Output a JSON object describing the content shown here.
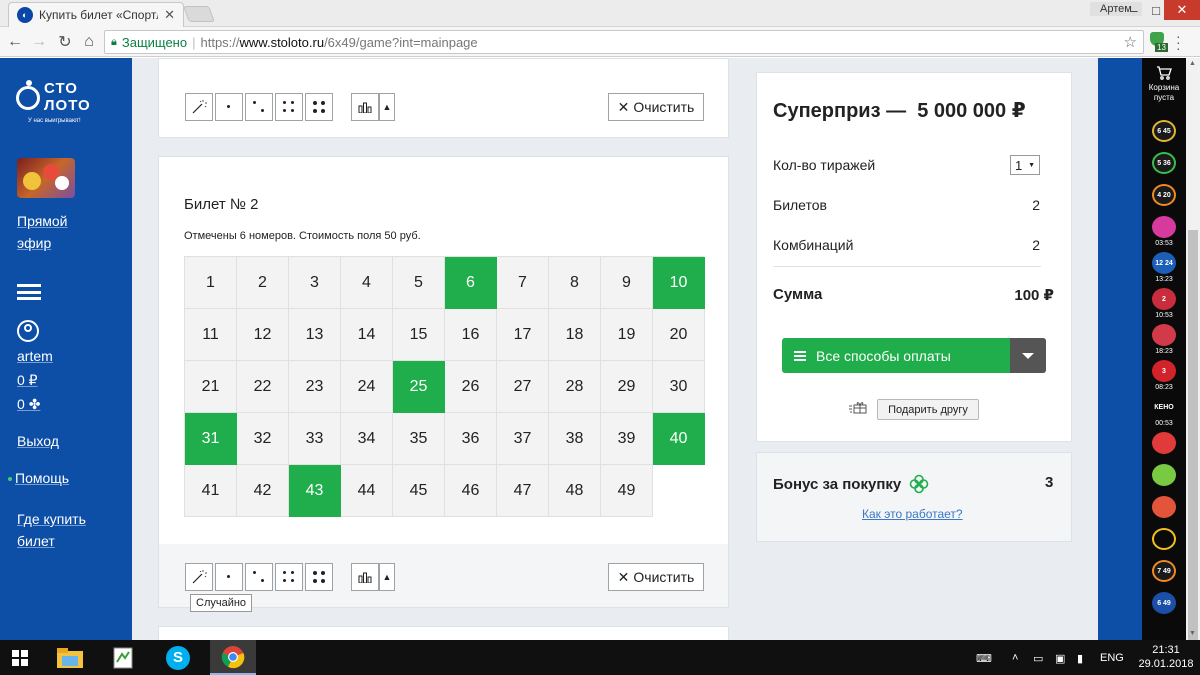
{
  "browser": {
    "tab_title": "Купить билет «Спортлото",
    "user": "Артем",
    "secure_label": "Защищено",
    "url_scheme": "https://",
    "url_host": "www.stoloto.ru",
    "url_path": "/6x49/game?int=mainpage",
    "extension_count": "13"
  },
  "logo": {
    "line1": "СТО",
    "line2": "ЛОТО",
    "slogan": "У нас выигрывают!"
  },
  "sidebar": {
    "live_line1": "Прямой",
    "live_line2": "эфир",
    "username": "artem",
    "balance": "0 ₽",
    "bonus_balance": "0",
    "logout": "Выход",
    "help": "Помощь",
    "where_line1": "Где купить",
    "where_line2": "билет"
  },
  "ticket": {
    "title": "Билет № 2",
    "note": "Отмечены 6 номеров. Стоимость поля 50 руб.",
    "numbers": [
      1,
      2,
      3,
      4,
      5,
      6,
      7,
      8,
      9,
      10,
      11,
      12,
      13,
      14,
      15,
      16,
      17,
      18,
      19,
      20,
      21,
      22,
      23,
      24,
      25,
      26,
      27,
      28,
      29,
      30,
      31,
      32,
      33,
      34,
      35,
      36,
      37,
      38,
      39,
      40,
      41,
      42,
      43,
      44,
      45,
      46,
      47,
      48,
      49
    ],
    "selected": [
      6,
      10,
      25,
      31,
      40,
      43
    ],
    "clear_label": "Очистить",
    "random_tooltip": "Случайно"
  },
  "summary": {
    "prize_label": "Суперприз —",
    "prize_value": "5 000 000 ₽",
    "draws_label": "Кол-во тиражей",
    "draws_value": "1",
    "tickets_label": "Билетов",
    "tickets_value": "2",
    "combos_label": "Комбинаций",
    "combos_value": "2",
    "total_label": "Сумма",
    "total_value": "100 ₽",
    "pay_label": "Все способы оплаты",
    "gift_label": "Подарить другу",
    "bonus_label": "Бонус за покупку",
    "bonus_value": "3",
    "how_label": "Как это работает?"
  },
  "games_strip": {
    "cart_line1": "Корзина",
    "cart_line2": "пуста",
    "games": [
      {
        "label": "6 45",
        "color": "#1a1a1a",
        "ring": "#e2b62f",
        "time": ""
      },
      {
        "label": "5 36",
        "color": "#1a1a1a",
        "ring": "#3cbf4a",
        "time": ""
      },
      {
        "label": "4 20",
        "color": "#1a1a1a",
        "ring": "#f08a24",
        "time": ""
      },
      {
        "label": "",
        "color": "#d63a9c",
        "ring": "#d63a9c",
        "time": "03:53"
      },
      {
        "label": "12 24",
        "color": "#1b5fb8",
        "ring": "#1b5fb8",
        "time": "13:23"
      },
      {
        "label": "2",
        "color": "#c72d3d",
        "ring": "#c72d3d",
        "time": "10:53"
      },
      {
        "label": "",
        "color": "#d23a4a",
        "ring": "#d23a4a",
        "time": "18:23"
      },
      {
        "label": "3",
        "color": "#d2232a",
        "ring": "#d2232a",
        "time": "08:23"
      },
      {
        "label": "КЕНО",
        "color": "#0a0a0a",
        "ring": "#0a0a0a",
        "time": "00:53"
      },
      {
        "label": "",
        "color": "#e03a3a",
        "ring": "#e03a3a",
        "time": ""
      },
      {
        "label": "",
        "color": "#7ac943",
        "ring": "#7ac943",
        "time": ""
      },
      {
        "label": "",
        "color": "#e2553a",
        "ring": "#e2553a",
        "time": ""
      },
      {
        "label": "",
        "color": "#0a0a0a",
        "ring": "#f2c21a",
        "time": ""
      },
      {
        "label": "7 49",
        "color": "#1a1a1a",
        "ring": "#f08a24",
        "time": ""
      },
      {
        "label": "6 49",
        "color": "#1b4fa8",
        "ring": "#1b4fa8",
        "time": ""
      }
    ]
  },
  "taskbar": {
    "lang": "ENG",
    "time": "21:31",
    "date": "29.01.2018"
  }
}
